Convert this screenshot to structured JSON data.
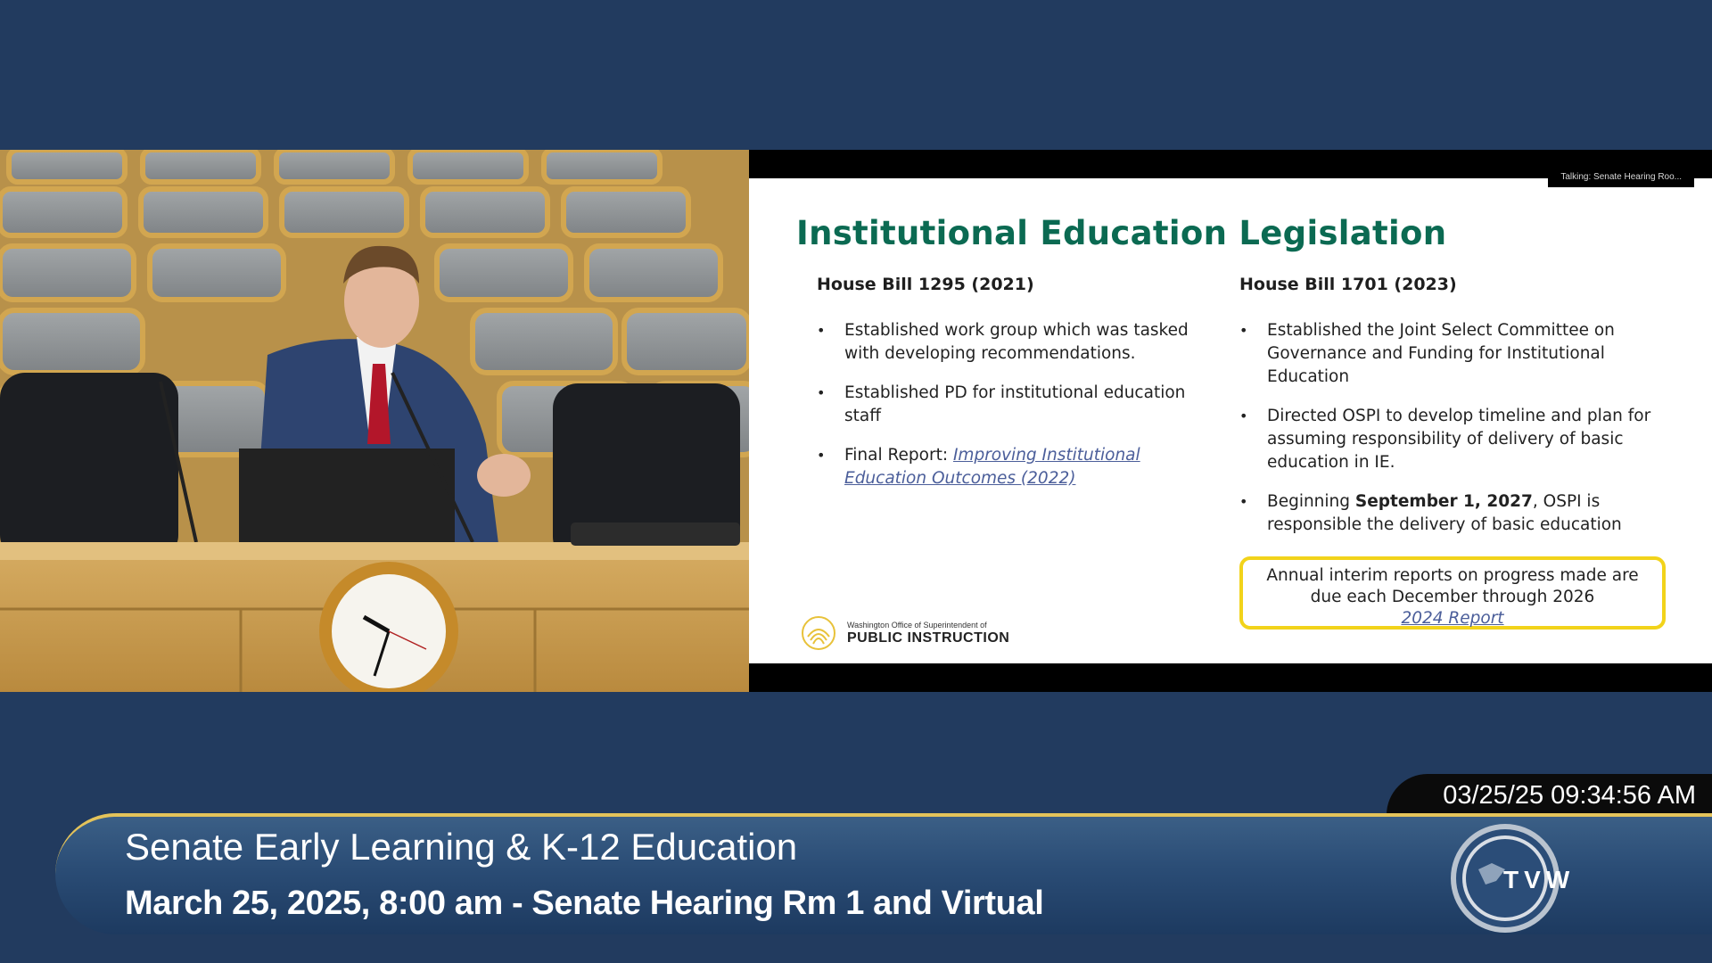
{
  "slide": {
    "talking_tag": "Talking: Senate Hearing Roo...",
    "title": "Institutional Education Legislation",
    "left_column": {
      "heading": "House Bill 1295 (2021)",
      "bullets": [
        "Established work group which was tasked with developing recommendations.",
        "Established PD for institutional education staff"
      ],
      "final_report_prefix": "Final Report: ",
      "final_report_link": "Improving Institutional Education Outcomes (2022)"
    },
    "right_column": {
      "heading": "House Bill 1701 (2023)",
      "bullets": [
        "Established the Joint Select Committee on Governance and Funding for Institutional Education",
        "Directed OSPI to develop timeline and plan for assuming responsibility of delivery of basic education in IE."
      ],
      "beginning_prefix": "Beginning ",
      "beginning_date": "September 1, 2027",
      "beginning_suffix": ", OSPI is responsible the delivery of basic education"
    },
    "report_box": {
      "line1": "Annual interim reports on progress made are",
      "line2": "due each December through 2026",
      "link": "2024 Report"
    },
    "logo": {
      "small_text": "Washington Office of Superintendent of",
      "big_text": "PUBLIC INSTRUCTION"
    }
  },
  "broadcast": {
    "timestamp": "03/25/25 09:34:56 AM",
    "title": "Senate Early Learning & K-12 Education",
    "subtitle": "March 25, 2025, 8:00 am - Senate Hearing Rm 1 and Virtual",
    "logo_text": "TVW"
  },
  "colors": {
    "background": "#223b5f",
    "slide_title": "#0b6a52",
    "report_border": "#f2d31a",
    "banner_accent": "#e4c35a"
  }
}
